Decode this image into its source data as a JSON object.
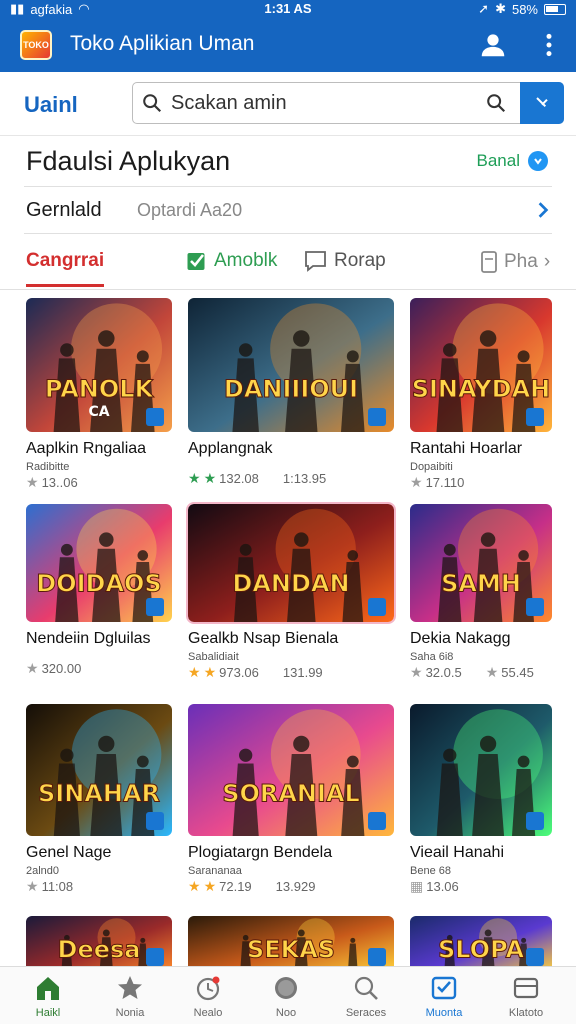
{
  "status_bar": {
    "carrier": "agfakia",
    "time": "1:31 AS",
    "battery": "58%"
  },
  "app_bar": {
    "logo_text": "TOKO",
    "title": "Toko Aplikian Uman"
  },
  "search": {
    "brand": "Uainl",
    "value": "Scakan amin"
  },
  "section": {
    "title": "Fdaulsi Aplukyan",
    "action": "Banal"
  },
  "filter": {
    "label": "Gernlald",
    "value": "Optardi Aa20"
  },
  "tabs": [
    {
      "label": "Cangrrai"
    },
    {
      "label": "Amoblk"
    },
    {
      "label": "Rorap"
    },
    {
      "label": "Pha"
    }
  ],
  "apps": [
    {
      "title": "Aaplkin Rngaliaa",
      "subtitle": "Radibitte",
      "rating": "13..06",
      "rating2": "",
      "star": "grey",
      "art_text": "PANOLK",
      "art_text2": "CA",
      "colors": [
        "#1b2a55",
        "#c2463a",
        "#f5a04a"
      ]
    },
    {
      "title": "Applangnak",
      "subtitle": "",
      "rating": "132.08",
      "rating2": "1:13.95",
      "star": "green2",
      "art_text": "DANIIIOUI",
      "art_text2": "",
      "colors": [
        "#0f2436",
        "#3d6e8a",
        "#e88b2a"
      ]
    },
    {
      "title": "Rantahi Hoarlar",
      "subtitle": "Dopaibiti",
      "rating": "17.110",
      "rating2": "",
      "star": "grey",
      "art_text": "SINAYDAH",
      "art_text2": "",
      "colors": [
        "#3b1f5a",
        "#d8382e",
        "#ffb63b"
      ]
    },
    {
      "title": "Nendeiin Dgluilas",
      "subtitle": "",
      "rating": "320.00",
      "rating2": "",
      "star": "grey",
      "art_text": "DOIDAOS",
      "art_text2": "",
      "colors": [
        "#2d6fd0",
        "#e83c6d",
        "#ffd34d"
      ]
    },
    {
      "title": "Gealkb Nsap Bienala",
      "subtitle": "Sabalidiait",
      "rating": "973.06",
      "rating2": "131.99",
      "star": "gold2",
      "art_text": "DANDAN",
      "art_text2": "",
      "colors": [
        "#120a12",
        "#8e1f1c",
        "#ff6a1a"
      ]
    },
    {
      "title": "Dekia Nakagg",
      "subtitle": "Saha 6i8",
      "rating": "32.0.5",
      "rating2": "55.45",
      "star": "grey2",
      "art_text": "SAMH",
      "art_text2": "",
      "colors": [
        "#2b2c8a",
        "#c62f88",
        "#ff8a2a"
      ]
    },
    {
      "title": "Genel Nage",
      "subtitle": "2alnd0",
      "rating": "11:08",
      "rating2": "",
      "star": "grey",
      "art_text": "SINAHAR",
      "art_text2": "",
      "colors": [
        "#140e08",
        "#6b4a12",
        "#2ab8ff"
      ]
    },
    {
      "title": "Plogiatargn Bendela",
      "subtitle": "Sarananaa",
      "rating": "72.19",
      "rating2": "13.929",
      "star": "gold2",
      "art_text": "SORANIAL",
      "art_text2": "",
      "colors": [
        "#6a2fb8",
        "#e84a8e",
        "#ffb73b"
      ]
    },
    {
      "title": "Vieail Hanahi",
      "subtitle": "Bene 68",
      "rating": "13.06",
      "rating2": "",
      "star": "none",
      "art_text": "",
      "art_text2": "",
      "colors": [
        "#0a1a2c",
        "#1e5a6a",
        "#4cff7a"
      ]
    },
    {
      "title": "",
      "subtitle": "",
      "rating": "",
      "rating2": "",
      "star": "none",
      "art_text": "Deesa",
      "art_text2": "",
      "colors": [
        "#1a1a3a",
        "#9a2a2a",
        "#ff8a2a"
      ]
    },
    {
      "title": "",
      "subtitle": "",
      "rating": "",
      "rating2": "",
      "star": "none",
      "art_text": "SEKAS",
      "art_text2": "",
      "colors": [
        "#2a1a0a",
        "#c85a1a",
        "#ffd23a"
      ]
    },
    {
      "title": "",
      "subtitle": "",
      "rating": "",
      "rating2": "",
      "star": "none",
      "art_text": "SLOPA",
      "art_text2": "",
      "colors": [
        "#1a2a6a",
        "#5a3ad0",
        "#ffd23a"
      ]
    }
  ],
  "bottom_nav": [
    {
      "label": "Haikl",
      "icon": "home-icon"
    },
    {
      "label": "Nonia",
      "icon": "star-icon"
    },
    {
      "label": "Nealo",
      "icon": "clock-icon"
    },
    {
      "label": "Noo",
      "icon": "circle-icon"
    },
    {
      "label": "Seraces",
      "icon": "search-icon"
    },
    {
      "label": "Muonta",
      "icon": "apps-icon"
    },
    {
      "label": "Klatoto",
      "icon": "card-icon"
    }
  ],
  "colors": {
    "primary": "#1565c0",
    "accent_red": "#d32f2f",
    "accent_green": "#2e9d52",
    "star_gold": "#f5a623"
  }
}
